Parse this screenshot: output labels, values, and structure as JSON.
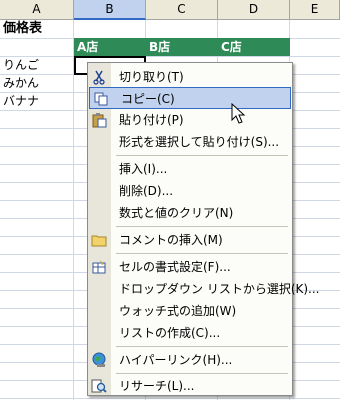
{
  "column_headers": [
    "A",
    "B",
    "C",
    "D",
    "E"
  ],
  "selected_column": "B",
  "row_values": {
    "title": "価格表",
    "store_headers": [
      "A店",
      "B店",
      "C店"
    ],
    "products": [
      "りんご",
      "みかん",
      "バナナ"
    ]
  },
  "header_fill_color": "#2E8B57",
  "context_menu": {
    "items": [
      {
        "label": "切り取り(T)",
        "icon": "scissors-icon",
        "highlighted": false
      },
      {
        "label": "コピー(C)",
        "icon": "copy-icon",
        "highlighted": true
      },
      {
        "label": "貼り付け(P)",
        "icon": "paste-icon",
        "highlighted": false
      },
      {
        "label": "形式を選択して貼り付け(S)...",
        "icon": "",
        "highlighted": false
      },
      {
        "label": "挿入(I)...",
        "icon": "",
        "highlighted": false
      },
      {
        "label": "削除(D)...",
        "icon": "",
        "highlighted": false
      },
      {
        "label": "数式と値のクリア(N)",
        "icon": "",
        "highlighted": false
      },
      {
        "label": "コメントの挿入(M)",
        "icon": "folder-icon",
        "highlighted": false
      },
      {
        "label": "セルの書式設定(F)...",
        "icon": "format-cells-icon",
        "highlighted": false
      },
      {
        "label": "ドロップダウン リストから選択(K)...",
        "icon": "",
        "highlighted": false
      },
      {
        "label": "ウォッチ式の追加(W)",
        "icon": "",
        "highlighted": false
      },
      {
        "label": "リストの作成(C)...",
        "icon": "",
        "highlighted": false
      },
      {
        "label": "ハイパーリンク(H)...",
        "icon": "hyperlink-globe-icon",
        "highlighted": false
      },
      {
        "label": "リサーチ(L)...",
        "icon": "research-icon",
        "highlighted": false
      }
    ]
  }
}
